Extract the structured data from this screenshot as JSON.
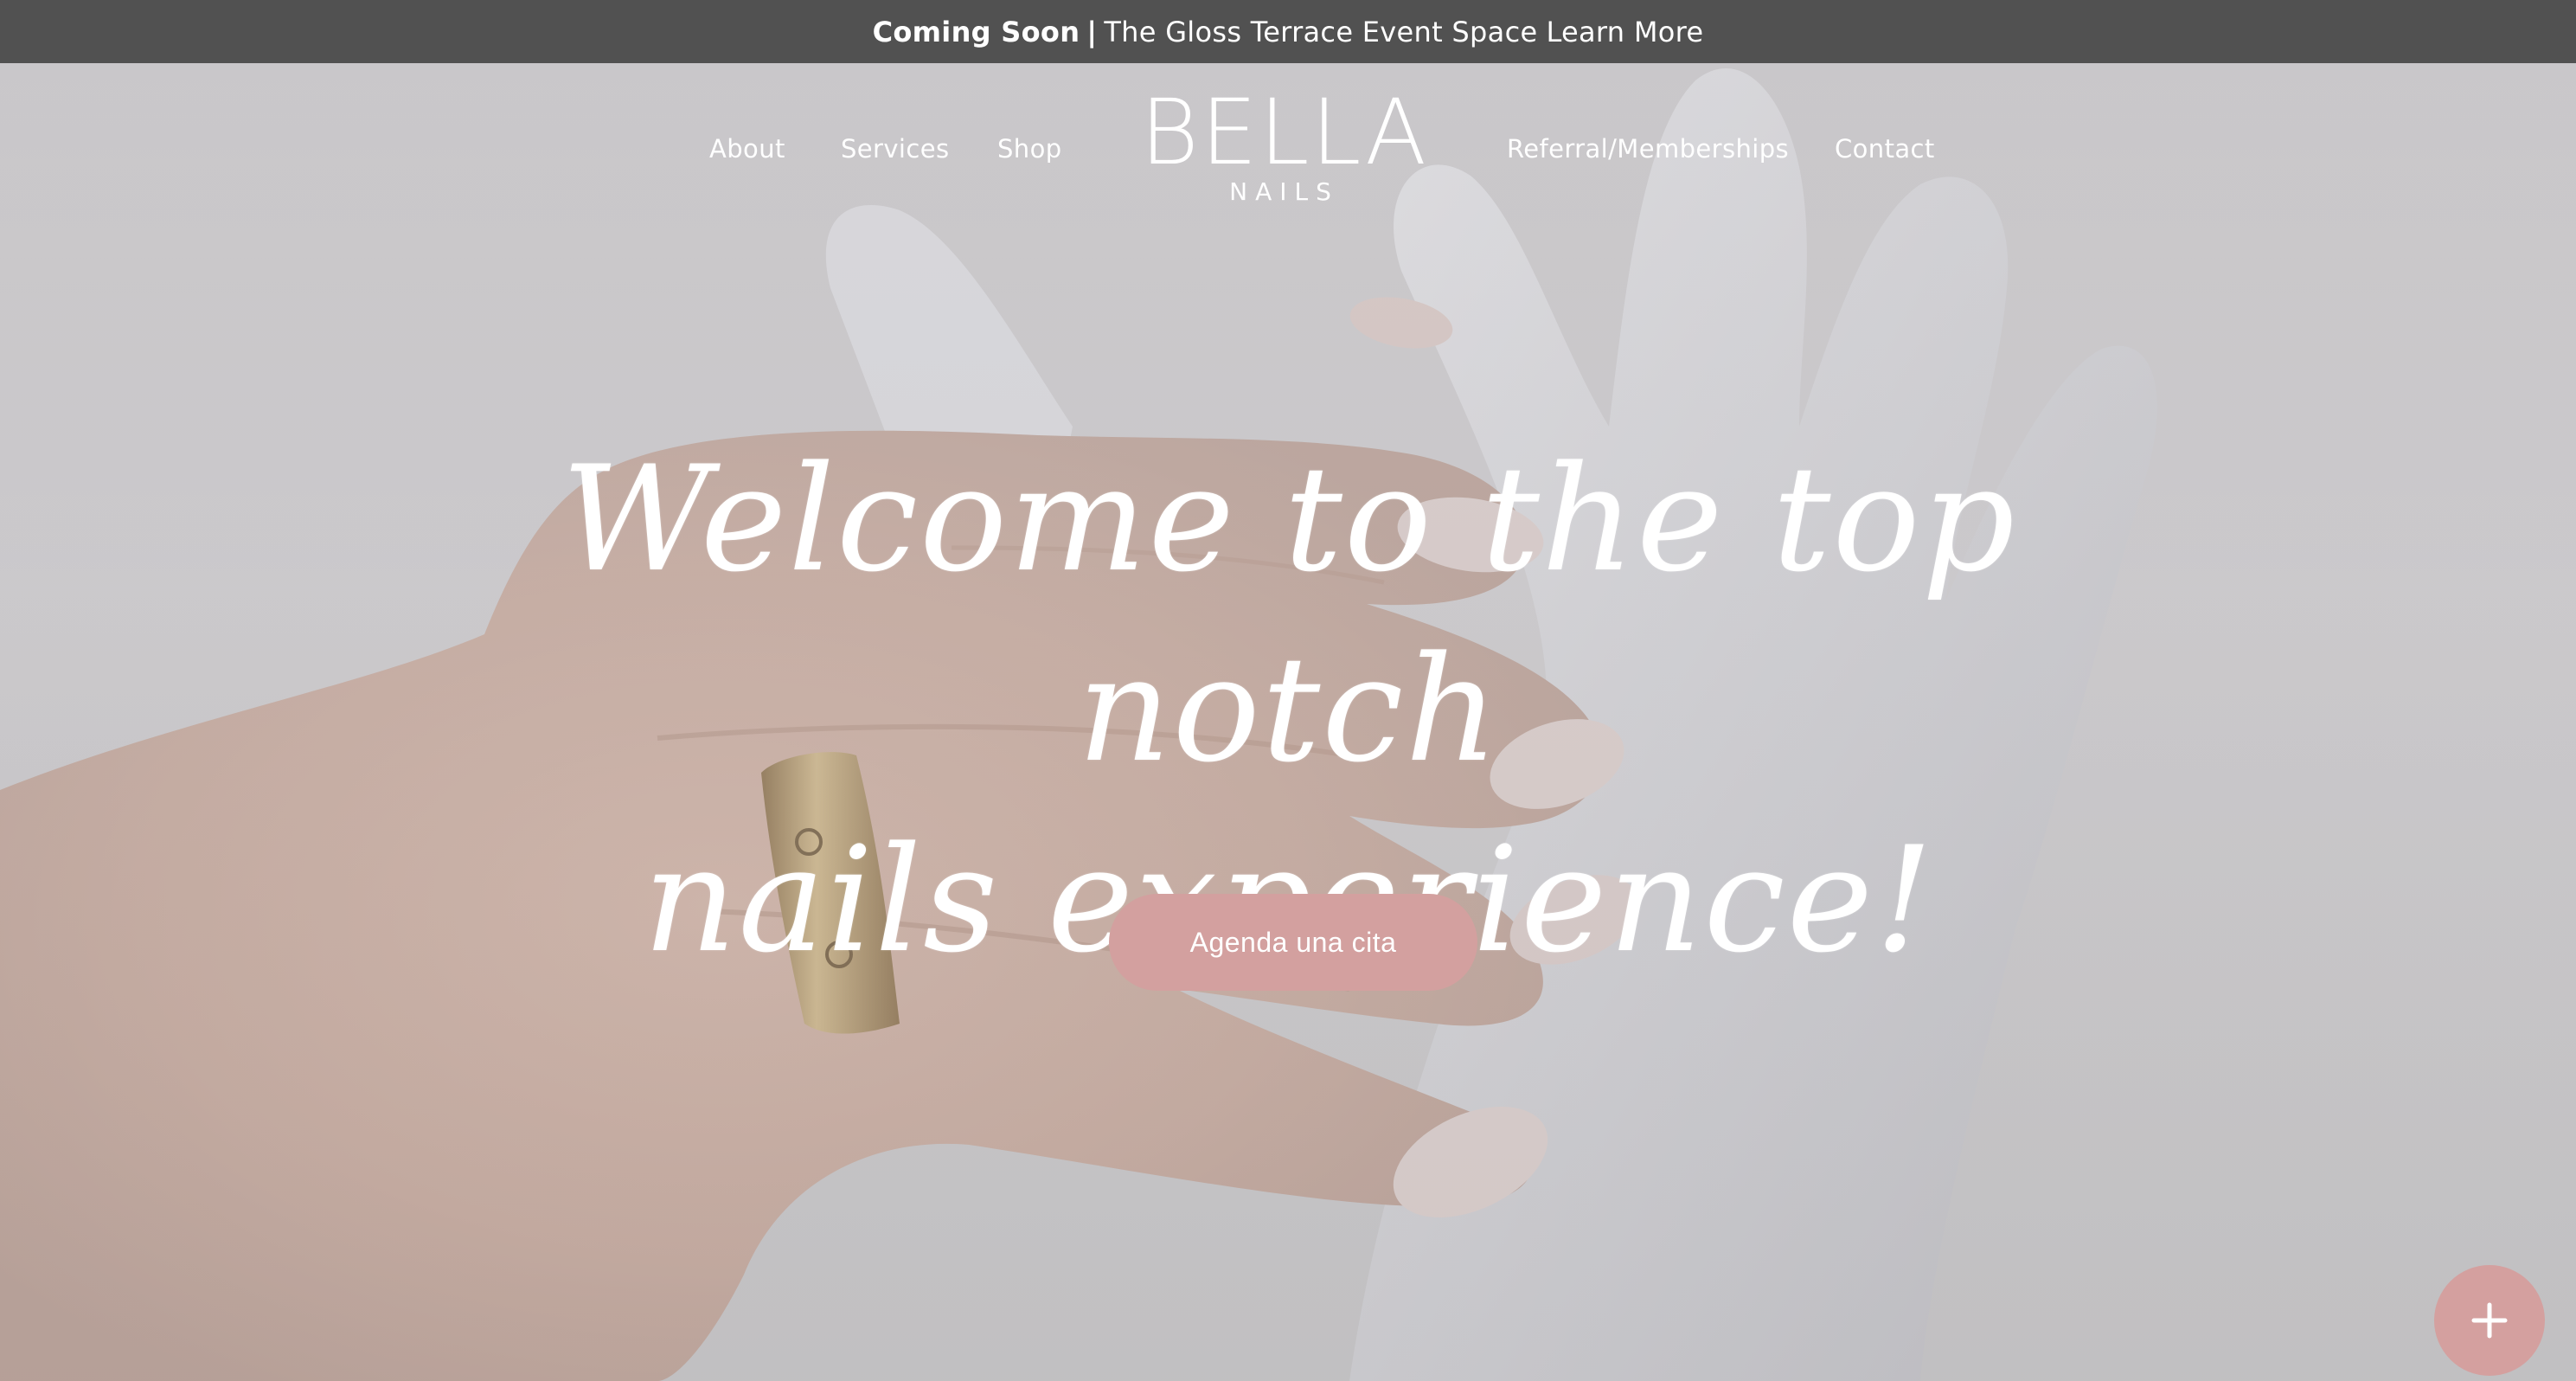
{
  "announcement": {
    "bold_text": "Coming Soon",
    "separator": "|",
    "text": "The Gloss Terrace Event Space",
    "link": "Learn More"
  },
  "nav": {
    "left": [
      "About",
      "Services",
      "Shop"
    ],
    "right": [
      "Referral/Memberships",
      "Contact"
    ]
  },
  "logo": {
    "main": "BELLA",
    "sub": "NAILS"
  },
  "hero": {
    "headline_line1": "Welcome to the top notch",
    "headline_line2": "nails experience!",
    "cta_label": "Agenda una cita"
  },
  "colors": {
    "announcement_bg": "#515151",
    "accent": "#d3a09f",
    "text": "#ffffff"
  },
  "icons": {
    "fab": "plus-icon"
  }
}
